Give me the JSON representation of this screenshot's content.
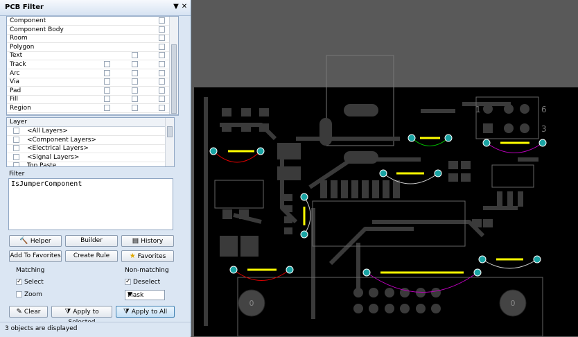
{
  "panel": {
    "title": "PCB Filter",
    "menu_glyph": "▼",
    "close_glyph": "✕"
  },
  "objects": [
    {
      "label": "Component",
      "checks": [
        false,
        false,
        true
      ]
    },
    {
      "label": "Component Body",
      "checks": [
        false,
        false,
        true
      ]
    },
    {
      "label": "Room",
      "checks": [
        false,
        false,
        true
      ]
    },
    {
      "label": "Polygon",
      "checks": [
        false,
        false,
        true
      ]
    },
    {
      "label": "Text",
      "checks": [
        false,
        true,
        true
      ]
    },
    {
      "label": "Track",
      "checks": [
        true,
        true,
        true
      ]
    },
    {
      "label": "Arc",
      "checks": [
        true,
        true,
        true
      ]
    },
    {
      "label": "Via",
      "checks": [
        true,
        true,
        true
      ]
    },
    {
      "label": "Pad",
      "checks": [
        true,
        true,
        true
      ]
    },
    {
      "label": "Fill",
      "checks": [
        true,
        true,
        true
      ]
    },
    {
      "label": "Region",
      "checks": [
        true,
        true,
        true
      ]
    }
  ],
  "layer": {
    "header": "Layer",
    "items": [
      "<All Layers>",
      "<Component Layers>",
      "<Electrical Layers>",
      "<Signal Layers>",
      "Top Paste"
    ]
  },
  "filter": {
    "label": "Filter",
    "query": "IsJumperComponent"
  },
  "buttons": {
    "helper": "Helper",
    "builder": "Builder",
    "history": "History",
    "add_to_favorites": "Add To Favorites",
    "create_rule": "Create Rule",
    "favorites": "Favorites",
    "clear": "Clear",
    "apply_to_selected": "Apply to Selected",
    "apply_to_all": "Apply to All"
  },
  "matching": {
    "label": "Matching",
    "select_label": "Select",
    "select_checked": true,
    "zoom_label": "Zoom",
    "zoom_checked": false
  },
  "non_matching": {
    "label": "Non-matching",
    "deselect_label": "Deselect",
    "deselect_checked": true,
    "mode": "Mask"
  },
  "status": "3 objects are displayed",
  "pcb_labels": {
    "pin_1": "1",
    "pin_6": "6",
    "pin_3": "3",
    "mount_hole": "0"
  },
  "colors": {
    "jumper": "#ffff00",
    "pad": "#1aa3a3",
    "board": "#000000",
    "canvas_bg": "#595959"
  }
}
